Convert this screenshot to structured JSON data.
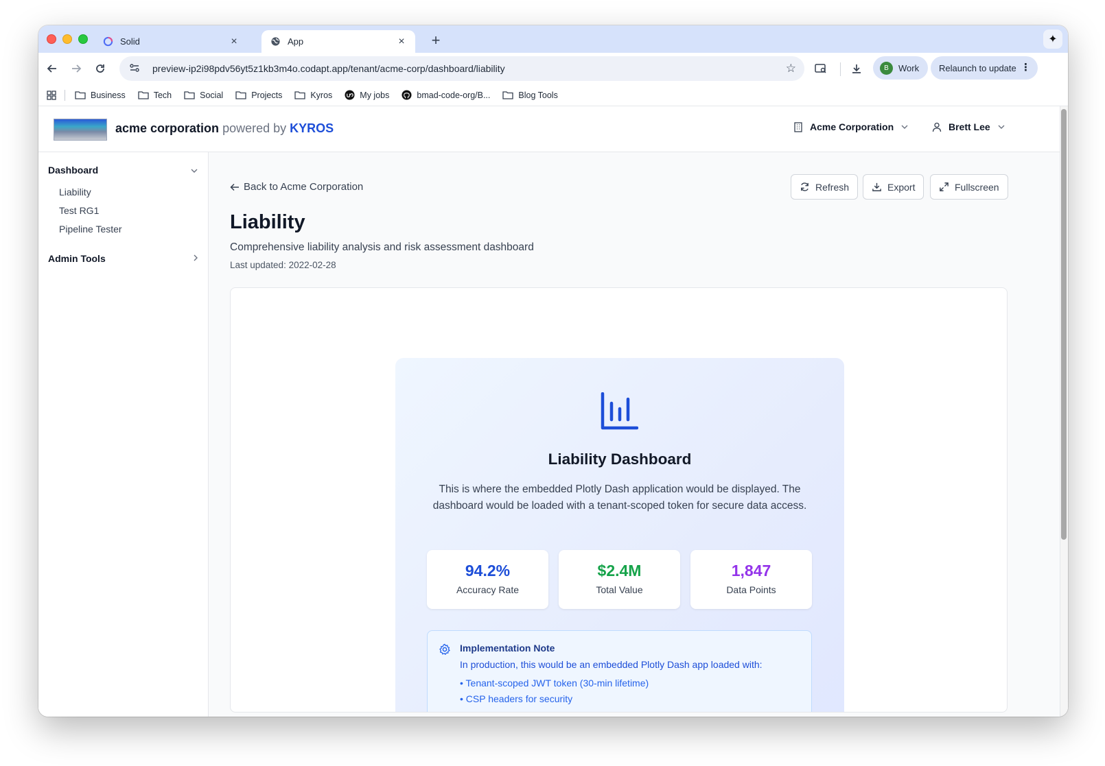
{
  "browser": {
    "tabs": [
      {
        "title": "Solid",
        "icon": "solid-logo-icon"
      },
      {
        "title": "App",
        "icon": "globe-icon"
      }
    ],
    "url": "preview-ip2i98pdv56yt5z1kb3m4o.codapt.app/tenant/acme-corp/dashboard/liability",
    "profile_initial": "B",
    "profile_label": "Work",
    "relaunch_label": "Relaunch to update",
    "bookmarks": [
      {
        "label": "Business",
        "icon": "folder-icon"
      },
      {
        "label": "Tech",
        "icon": "folder-icon"
      },
      {
        "label": "Social",
        "icon": "folder-icon"
      },
      {
        "label": "Projects",
        "icon": "folder-icon"
      },
      {
        "label": "Kyros",
        "icon": "folder-icon"
      },
      {
        "label": "My jobs",
        "icon": "upwork-icon"
      },
      {
        "label": "bmad-code-org/B...",
        "icon": "github-icon"
      },
      {
        "label": "Blog Tools",
        "icon": "folder-icon"
      }
    ]
  },
  "header": {
    "brand_name": "acme corporation",
    "brand_powered": "powered by",
    "brand_product": "KYROS",
    "tenant": "Acme Corporation",
    "user": "Brett Lee"
  },
  "sidebar": {
    "sections": [
      {
        "label": "Dashboard",
        "expanded": true,
        "items": [
          "Liability",
          "Test RG1",
          "Pipeline Tester"
        ]
      },
      {
        "label": "Admin Tools",
        "expanded": false,
        "items": []
      }
    ]
  },
  "main": {
    "back_label": "Back to Acme Corporation",
    "actions": {
      "refresh": "Refresh",
      "export": "Export",
      "fullscreen": "Fullscreen"
    },
    "title": "Liability",
    "description": "Comprehensive liability analysis and risk assessment dashboard",
    "last_updated": "Last updated: 2022-02-28",
    "placeholder": {
      "title": "Liability Dashboard",
      "text": "This is where the embedded Plotly Dash application would be displayed. The dashboard would be loaded with a tenant-scoped token for secure data access.",
      "stats": [
        {
          "value": "94.2%",
          "label": "Accuracy Rate",
          "color": "#1d4ed8"
        },
        {
          "value": "$2.4M",
          "label": "Total Value",
          "color": "#16a34a"
        },
        {
          "value": "1,847",
          "label": "Data Points",
          "color": "#9333ea"
        }
      ],
      "note": {
        "title": "Implementation Note",
        "text": "In production, this would be an embedded Plotly Dash app loaded with:",
        "bullets": [
          "• Tenant-scoped JWT token (30-min lifetime)",
          "• CSP headers for security"
        ]
      }
    }
  },
  "colors": {
    "accent": "#1d4ed8",
    "tab_strip": "#d6e2fb"
  }
}
